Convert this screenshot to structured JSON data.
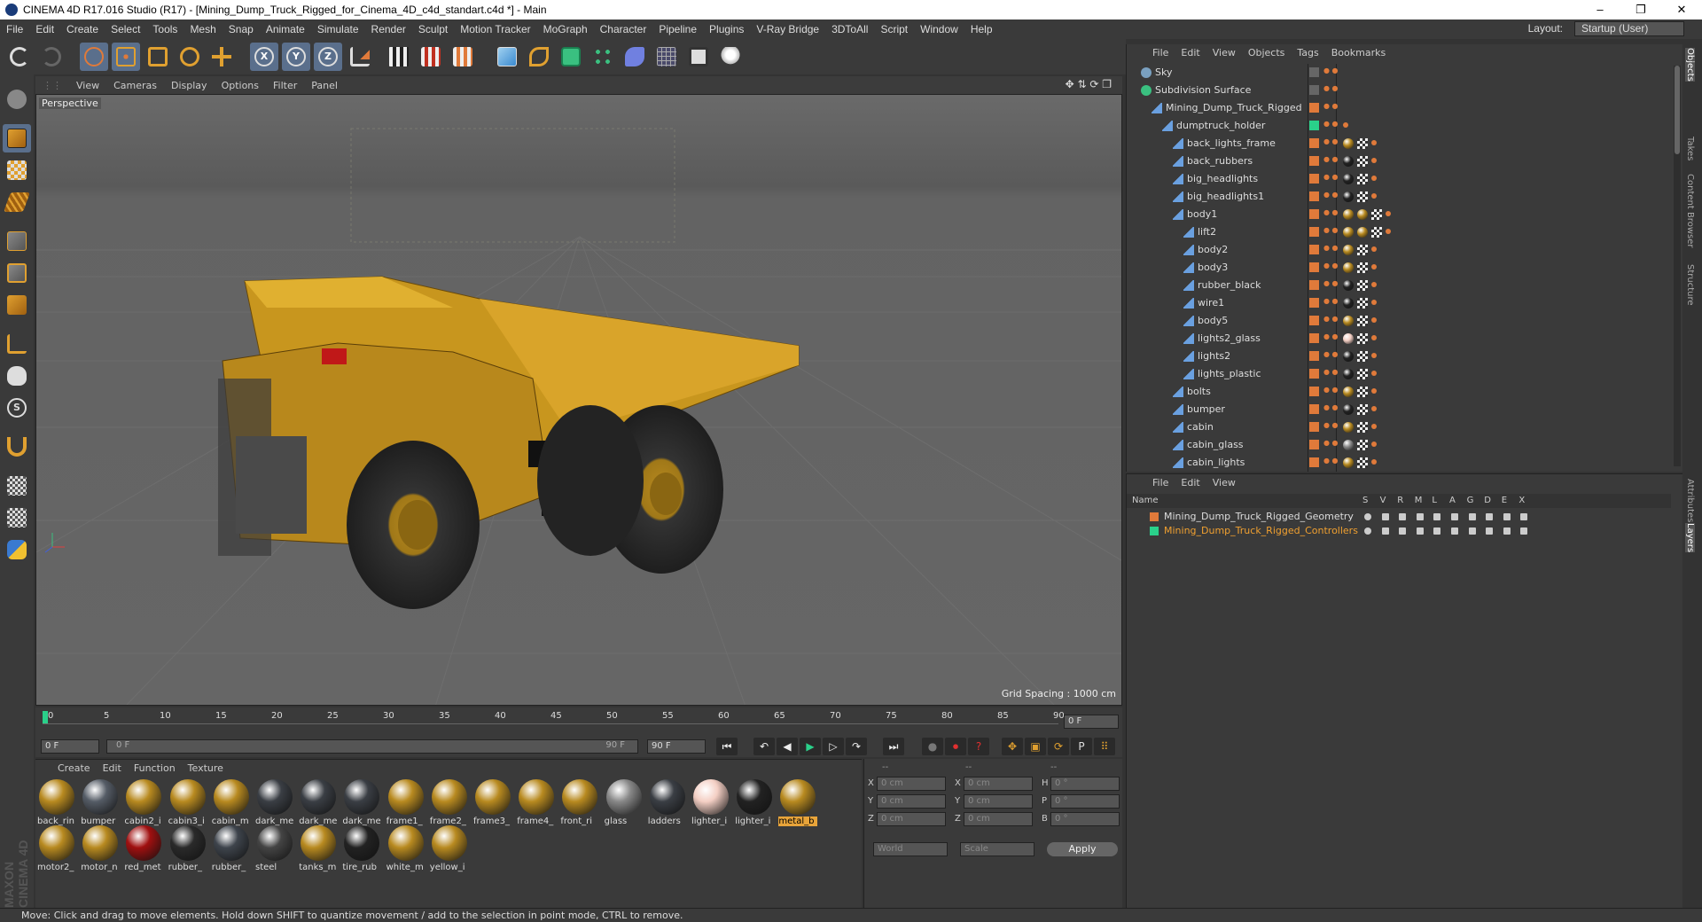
{
  "window": {
    "title": "CINEMA 4D R17.016 Studio (R17) - [Mining_Dump_Truck_Rigged_for_Cinema_4D_c4d_standart.c4d *] - Main",
    "minimize": "–",
    "maximize": "❐",
    "close": "✕"
  },
  "menu": [
    "File",
    "Edit",
    "Create",
    "Select",
    "Tools",
    "Mesh",
    "Snap",
    "Animate",
    "Simulate",
    "Render",
    "Sculpt",
    "Motion Tracker",
    "MoGraph",
    "Character",
    "Pipeline",
    "Plugins",
    "V-Ray Bridge",
    "3DToAll",
    "Script",
    "Window",
    "Help"
  ],
  "layout": {
    "label": "Layout:",
    "value": "Startup (User)"
  },
  "toolbar_axis": [
    "X",
    "Y",
    "Z"
  ],
  "viewport": {
    "menu": [
      "View",
      "Cameras",
      "Display",
      "Options",
      "Filter",
      "Panel"
    ],
    "label": "Perspective",
    "grid_spacing": "Grid Spacing : 1000 cm"
  },
  "timeline": {
    "ticks": [
      "0",
      "5",
      "10",
      "15",
      "20",
      "25",
      "30",
      "35",
      "40",
      "45",
      "50",
      "55",
      "60",
      "65",
      "70",
      "75",
      "80",
      "85",
      "90"
    ],
    "frame_end_field": "0 F",
    "start": "0 F",
    "range_start": "0 F",
    "range_end": "90 F",
    "end": "90 F"
  },
  "materials": {
    "menu": [
      "Create",
      "Edit",
      "Function",
      "Texture"
    ],
    "row1": [
      {
        "name": "back_rin",
        "color": "#b88a20"
      },
      {
        "name": "bumper",
        "color": "#555c66"
      },
      {
        "name": "cabin2_i",
        "color": "#b88a20"
      },
      {
        "name": "cabin3_i",
        "color": "#b88a20"
      },
      {
        "name": "cabin_m",
        "color": "#b88a20"
      },
      {
        "name": "dark_me",
        "color": "#3a3e44"
      },
      {
        "name": "dark_me",
        "color": "#3a3e44"
      },
      {
        "name": "dark_me",
        "color": "#3a3e44"
      },
      {
        "name": "frame1_",
        "color": "#b88a20"
      },
      {
        "name": "frame2_",
        "color": "#b88a20"
      },
      {
        "name": "frame3_",
        "color": "#b88a20"
      },
      {
        "name": "frame4_",
        "color": "#b88a20"
      },
      {
        "name": "front_ri",
        "color": "#b88a20"
      },
      {
        "name": "glass",
        "color": "#888"
      },
      {
        "name": "ladders",
        "color": "#3a3e44"
      },
      {
        "name": "lighter_i",
        "color": "#f4cfc4"
      },
      {
        "name": "lighter_i",
        "color": "#222"
      },
      {
        "name": "metal_b",
        "color": "#b88a20"
      }
    ],
    "row2": [
      {
        "name": "motor2_",
        "color": "#b88a20"
      },
      {
        "name": "motor_n",
        "color": "#b88a20"
      },
      {
        "name": "red_met",
        "color": "#a01010"
      },
      {
        "name": "rubber_",
        "color": "#2a2a2a"
      },
      {
        "name": "rubber_",
        "color": "#3e444c"
      },
      {
        "name": "steel",
        "color": "#444"
      },
      {
        "name": "tanks_m",
        "color": "#b88a20"
      },
      {
        "name": "tire_rub",
        "color": "#222"
      },
      {
        "name": "white_m",
        "color": "#b88a20"
      },
      {
        "name": "yellow_i",
        "color": "#b88a20"
      }
    ],
    "selected": "metal_b"
  },
  "coords": {
    "header": [
      "--",
      "--",
      "--"
    ],
    "rows": [
      {
        "a": "X",
        "av": "0 cm",
        "b": "X",
        "bv": "0 cm",
        "c": "H",
        "cv": "0 °"
      },
      {
        "a": "Y",
        "av": "0 cm",
        "b": "Y",
        "bv": "0 cm",
        "c": "P",
        "cv": "0 °"
      },
      {
        "a": "Z",
        "av": "0 cm",
        "b": "Z",
        "bv": "0 cm",
        "c": "B",
        "cv": "0 °"
      }
    ],
    "mode1": "World",
    "mode2": "Scale",
    "apply": "Apply"
  },
  "objects": {
    "menu": [
      "File",
      "Edit",
      "View",
      "Objects",
      "Tags",
      "Bookmarks"
    ],
    "rows": [
      {
        "name": "Sky",
        "indent": 0,
        "swatch": "",
        "tags": ""
      },
      {
        "name": "Subdivision Surface",
        "indent": 0,
        "swatch": "",
        "tags": ""
      },
      {
        "name": "Mining_Dump_Truck_Rigged",
        "indent": 1,
        "swatch": "#e07a3a",
        "tags": ""
      },
      {
        "name": "dumptruck_holder",
        "indent": 2,
        "swatch": "#2ad08a",
        "tags": "d"
      },
      {
        "name": "back_lights_frame",
        "indent": 3,
        "swatch": "#e07a3a",
        "tags": "y"
      },
      {
        "name": "back_rubbers",
        "indent": 3,
        "swatch": "#e07a3a",
        "tags": "k"
      },
      {
        "name": "big_headlights",
        "indent": 3,
        "swatch": "#e07a3a",
        "tags": "k"
      },
      {
        "name": "big_headlights1",
        "indent": 3,
        "swatch": "#e07a3a",
        "tags": "k"
      },
      {
        "name": "body1",
        "indent": 3,
        "swatch": "#e07a3a",
        "tags": "yy"
      },
      {
        "name": "lift2",
        "indent": 4,
        "swatch": "#e07a3a",
        "tags": "yy"
      },
      {
        "name": "body2",
        "indent": 4,
        "swatch": "#e07a3a",
        "tags": "y"
      },
      {
        "name": "body3",
        "indent": 4,
        "swatch": "#e07a3a",
        "tags": "y"
      },
      {
        "name": "rubber_black",
        "indent": 4,
        "swatch": "#e07a3a",
        "tags": "k"
      },
      {
        "name": "wire1",
        "indent": 4,
        "swatch": "#e07a3a",
        "tags": "k"
      },
      {
        "name": "body5",
        "indent": 4,
        "swatch": "#e07a3a",
        "tags": "y"
      },
      {
        "name": "lights2_glass",
        "indent": 4,
        "swatch": "#e07a3a",
        "tags": "p"
      },
      {
        "name": "lights2",
        "indent": 4,
        "swatch": "#e07a3a",
        "tags": "k"
      },
      {
        "name": "lights_plastic",
        "indent": 4,
        "swatch": "#e07a3a",
        "tags": "k"
      },
      {
        "name": "bolts",
        "indent": 3,
        "swatch": "#e07a3a",
        "tags": "y"
      },
      {
        "name": "bumper",
        "indent": 3,
        "swatch": "#e07a3a",
        "tags": "k"
      },
      {
        "name": "cabin",
        "indent": 3,
        "swatch": "#e07a3a",
        "tags": "y"
      },
      {
        "name": "cabin_glass",
        "indent": 3,
        "swatch": "#e07a3a",
        "tags": "g"
      },
      {
        "name": "cabin_lights",
        "indent": 3,
        "swatch": "#e07a3a",
        "tags": "y"
      }
    ]
  },
  "layers": {
    "menu": [
      "File",
      "Edit",
      "View"
    ],
    "header_name": "Name",
    "header_cols": [
      "S",
      "V",
      "R",
      "M",
      "L",
      "A",
      "G",
      "D",
      "E",
      "X"
    ],
    "rows": [
      {
        "name": "Mining_Dump_Truck_Rigged_Geometry",
        "color": "#e07a3a",
        "text": "#ddd"
      },
      {
        "name": "Mining_Dump_Truck_Rigged_Controllers",
        "color": "#2ad08a",
        "text": "#f0a030"
      }
    ]
  },
  "side_tabs": [
    "Objects",
    "Takes",
    "Content Browser",
    "Structure",
    "Attributes",
    "Layers"
  ],
  "status": "Move: Click and drag to move elements. Hold down SHIFT to quantize movement / add to the selection in point mode, CTRL to remove.",
  "brand": "MAXON CINEMA 4D"
}
